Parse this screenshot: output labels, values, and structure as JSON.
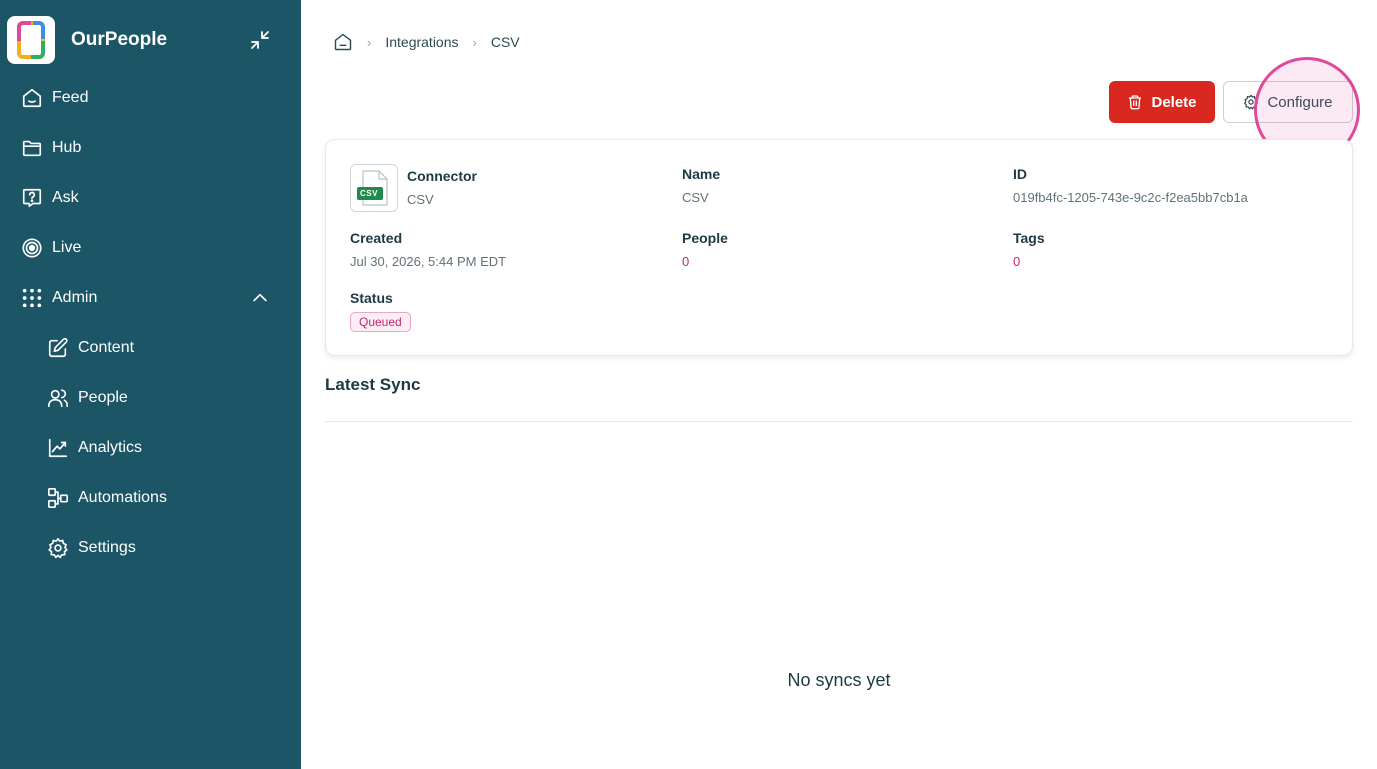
{
  "app": {
    "name": "OurPeople"
  },
  "sidebar": {
    "items": [
      {
        "label": "Feed",
        "icon": "home-icon"
      },
      {
        "label": "Hub",
        "icon": "folder-icon"
      },
      {
        "label": "Ask",
        "icon": "question-icon"
      },
      {
        "label": "Live",
        "icon": "live-icon"
      },
      {
        "label": "Admin",
        "icon": "grid-icon",
        "expanded": true
      }
    ],
    "admin_items": [
      {
        "label": "Content",
        "icon": "edit-icon"
      },
      {
        "label": "People",
        "icon": "users-icon"
      },
      {
        "label": "Analytics",
        "icon": "chart-icon"
      },
      {
        "label": "Automations",
        "icon": "automation-icon"
      },
      {
        "label": "Settings",
        "icon": "gear-icon"
      }
    ]
  },
  "breadcrumb": {
    "items": [
      "Integrations",
      "CSV"
    ]
  },
  "actions": {
    "delete_label": "Delete",
    "configure_label": "Configure"
  },
  "details": {
    "connector_label": "Connector",
    "connector_value": "CSV",
    "connector_badge": "CSV",
    "name_label": "Name",
    "name_value": "CSV",
    "id_label": "ID",
    "id_value": "019fb4fc-1205-743e-9c2c-f2ea5bb7cb1a",
    "created_label": "Created",
    "created_value": "Jul 30, 2026, 5:44 PM EDT",
    "people_label": "People",
    "people_value": "0",
    "tags_label": "Tags",
    "tags_value": "0",
    "status_label": "Status",
    "status_value": "Queued"
  },
  "sync": {
    "title": "Latest Sync",
    "empty_message": "No syncs yet"
  },
  "colors": {
    "sidebar": "#1b5566",
    "danger": "#d8281f",
    "accent": "#c0266f",
    "highlight": "#e0489a"
  }
}
